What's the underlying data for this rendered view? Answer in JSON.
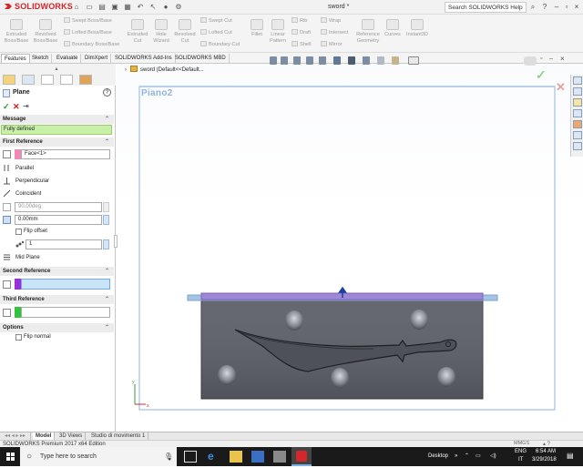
{
  "app": {
    "brand": "SOLIDWORKS",
    "doc_title": "sword *",
    "search_placeholder": "Search SOLIDWORKS Help"
  },
  "ribbon": {
    "big": [
      {
        "label": "Extruded Boss/Base",
        "l1": "Extruded",
        "l2": "Boss/Base"
      },
      {
        "label": "Revolved Boss/Base",
        "l1": "Revolved",
        "l2": "Boss/Base"
      },
      {
        "label": "Extruded Cut",
        "l1": "Extruded",
        "l2": "Cut"
      },
      {
        "label": "Hole Wizard",
        "l1": "Hole",
        "l2": "Wizard"
      },
      {
        "label": "Revolved Cut",
        "l1": "Revolved",
        "l2": "Cut"
      },
      {
        "label": "Fillet",
        "l1": "Fillet",
        "l2": ""
      },
      {
        "label": "Linear Pattern",
        "l1": "Linear",
        "l2": "Pattern"
      },
      {
        "label": "Reference Geometry",
        "l1": "Reference",
        "l2": "Geometry"
      },
      {
        "label": "Curves",
        "l1": "Curves",
        "l2": ""
      },
      {
        "label": "Instant3D",
        "l1": "Instant3D",
        "l2": ""
      }
    ],
    "small": [
      "Swept Boss/Base",
      "Lofted Boss/Base",
      "Boundary Boss/Base",
      "Swept Cut",
      "Lofted Cut",
      "Boundary Cut",
      "Rib",
      "Draft",
      "Shell",
      "Wrap",
      "Intersect",
      "Mirror"
    ]
  },
  "tabs": [
    "Features",
    "Sketch",
    "Evaluate",
    "DimXpert",
    "SOLIDWORKS Add-Ins",
    "SOLIDWORKS MBD"
  ],
  "tree": {
    "item": "sword  (Default<<Default..."
  },
  "pm": {
    "title": "Plane",
    "message_header": "Message",
    "message": "Fully defined",
    "first_ref_header": "First Reference",
    "first_ref_value": "Face<1>",
    "options": [
      "Parallel",
      "Perpendicular",
      "Coincident"
    ],
    "angle": "90.00deg",
    "distance": "0.00mm",
    "flip_offset": "Flip offset",
    "count": "1",
    "mid_plane": "Mid Plane",
    "second_ref_header": "Second Reference",
    "third_ref_header": "Third Reference",
    "options_header": "Options",
    "flip_normal": "Flip normal"
  },
  "graphics": {
    "plane_label": "Piano2"
  },
  "bottom_tabs": [
    "Model",
    "3D Views",
    "Studio di movimento 1"
  ],
  "status": {
    "left": "SOLIDWORKS Premium 2017 x64 Edition",
    "units": "MMGS"
  },
  "taskbar": {
    "search": "Type here to search",
    "desktop": "Desktop",
    "time": "6:54 AM",
    "date": "3/29/2018",
    "lang": "ENG",
    "region": "IT"
  },
  "colors": {
    "accent_red": "#d4262b",
    "plane_blue": "#8fb3de",
    "message_green": "#c9f0a8",
    "part_gray": "#5e6068"
  }
}
